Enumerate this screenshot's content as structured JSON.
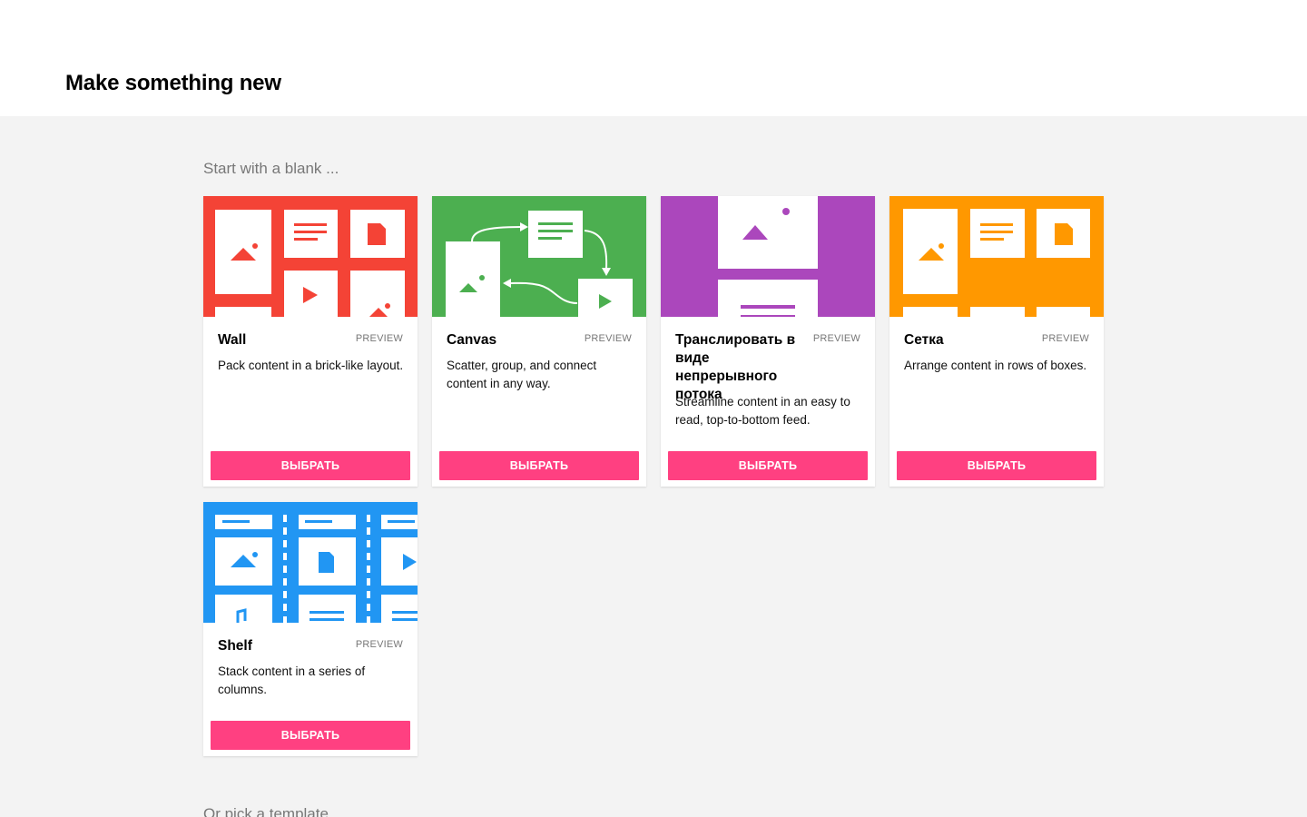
{
  "header": {
    "title": "Make something new"
  },
  "sections": {
    "blank": "Start with a blank ...",
    "template": "Or pick a template ..."
  },
  "cards": [
    {
      "name": "Wall",
      "badge": "PREVIEW",
      "description": "Pack content in a brick-like layout.",
      "button": "ВЫБРАТЬ",
      "color": "#f44336"
    },
    {
      "name": "Canvas",
      "badge": "PREVIEW",
      "description": "Scatter, group, and connect content in any way.",
      "button": "ВЫБРАТЬ",
      "color": "#4caf50"
    },
    {
      "name": "Транслировать в виде непрерывного потока",
      "badge": "PREVIEW",
      "description": "Streamline content in an easy to read, top-to-bottom feed.",
      "button": "ВЫБРАТЬ",
      "color": "#ab47bc"
    },
    {
      "name": "Сетка",
      "badge": "PREVIEW",
      "description": "Arrange content in rows of boxes.",
      "button": "ВЫБРАТЬ",
      "color": "#ff9800"
    },
    {
      "name": "Shelf",
      "badge": "PREVIEW",
      "description": "Stack content in a series of columns.",
      "button": "ВЫБРАТЬ",
      "color": "#2196f3"
    }
  ],
  "colors": {
    "accent": "#ff4081",
    "background": "#f3f3f3"
  }
}
